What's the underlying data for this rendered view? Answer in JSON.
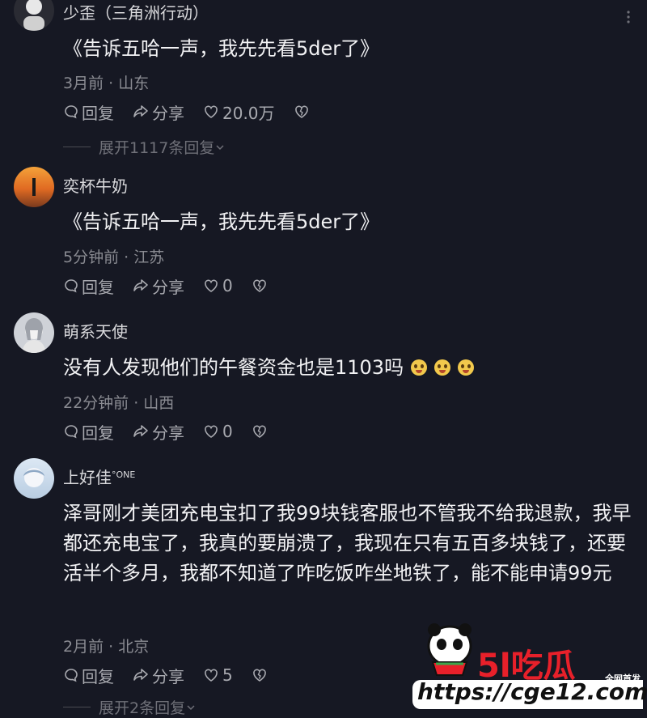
{
  "comments": [
    {
      "username": "少歪（三角洲行动）",
      "content": "《告诉五哈一声，我先先看5der了》",
      "meta": "3月前 · 山东",
      "reply_label": "回复",
      "share_label": "分享",
      "like_count": "20.0万",
      "expand_label": "展开1117条回复"
    },
    {
      "username": "奕杯牛奶",
      "content": "《告诉五哈一声，我先先看5der了》",
      "meta": "5分钟前 · 江苏",
      "reply_label": "回复",
      "share_label": "分享",
      "like_count": "0"
    },
    {
      "username": "萌系天使",
      "content": "没有人发现他们的午餐资金也是1103吗",
      "meta": "22分钟前 · 山西",
      "reply_label": "回复",
      "share_label": "分享",
      "like_count": "0"
    },
    {
      "username": "上好佳",
      "username_badge": "°ONE",
      "content": "泽哥刚才美团充电宝扣了我99块钱客服也不管我不给我退款，我早都还充电宝了，我真的要崩溃了，我现在只有五百多块钱了，还要活半个多月，我都不知道了咋吃饭咋坐地铁了，能不能申请99元",
      "meta": "2月前 · 北京",
      "reply_label": "回复",
      "share_label": "分享",
      "like_count": "5",
      "expand_label": "展开2条回复"
    }
  ],
  "watermark": {
    "brand": "吃瓜",
    "sub": "全网首发",
    "url": "https://cge12.com"
  },
  "colors": {
    "background": "#161823",
    "text_primary": "#f2f2f4",
    "text_secondary": "#8a8b92",
    "watermark_red": "#e8202a"
  }
}
